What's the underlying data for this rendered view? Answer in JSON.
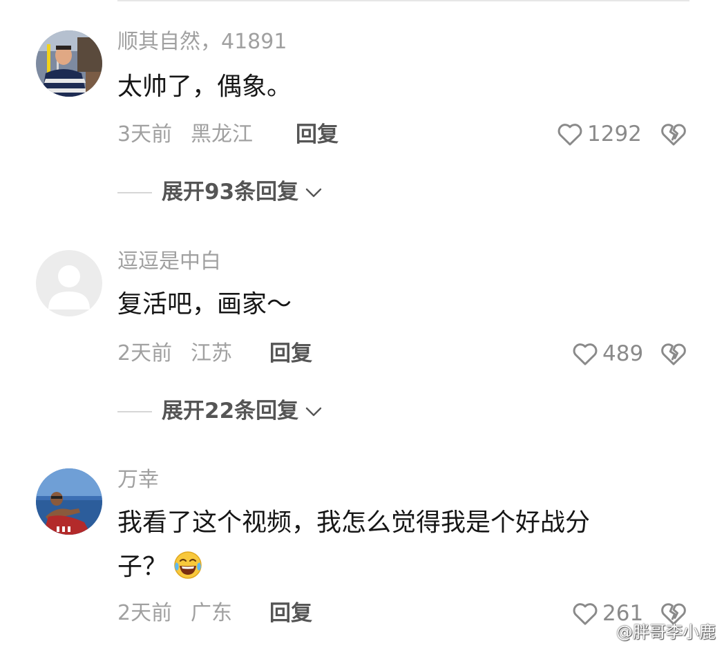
{
  "comments": [
    {
      "username": "顺其自然，41891",
      "text_lines": [
        "太帅了，偶象。"
      ],
      "time": "3天前",
      "location": "黑龙江",
      "reply_label": "回复",
      "likes": "1292",
      "expand_label": "展开93条回复",
      "avatar_icon": "user-photo-avatar"
    },
    {
      "username": "逗逗是中白",
      "text_lines": [
        "复活吧，画家～"
      ],
      "time": "2天前",
      "location": "江苏",
      "reply_label": "回复",
      "likes": "489",
      "expand_label": "展开22条回复",
      "avatar_icon": "default-avatar"
    },
    {
      "username": "万幸",
      "text_lines": [
        "我看了这个视频，我怎么觉得我是个好战分",
        "子？"
      ],
      "emoji": "tears-of-joy-emoji",
      "time": "2天前",
      "location": "广东",
      "reply_label": "回复",
      "likes": "261",
      "avatar_icon": "user-photo-avatar"
    }
  ],
  "watermark": {
    "text": "@胖哥李小鹿",
    "icon": "weibo-logo-icon"
  },
  "colors": {
    "username": "#a0a0a0",
    "comment_text": "#161616",
    "meta": "#a0a0a0",
    "reply": "#555555",
    "like": "#8a8a8a"
  }
}
